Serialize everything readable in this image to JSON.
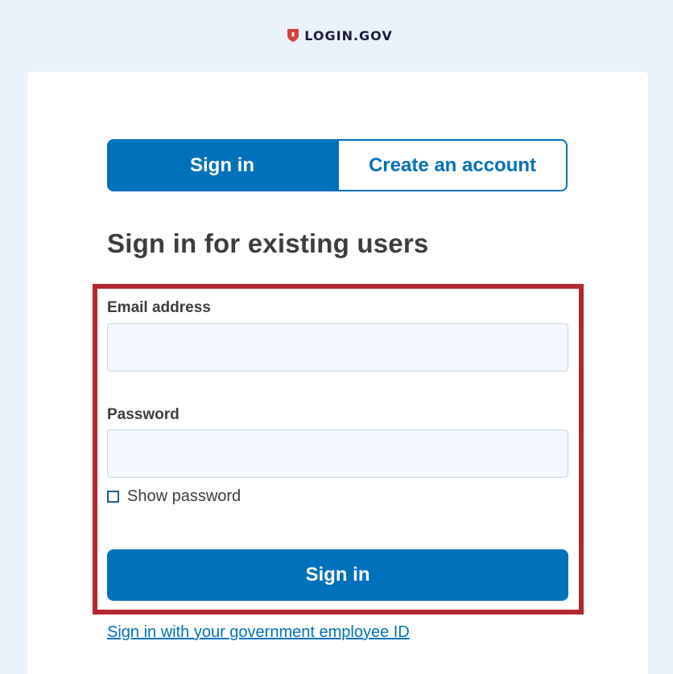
{
  "header": {
    "logo_text": "LOGIN.GOV",
    "logo_icon": "shield-icon"
  },
  "tabs": [
    {
      "label": "Sign in",
      "selected": true
    },
    {
      "label": "Create an account",
      "selected": false
    }
  ],
  "main": {
    "title": "Sign in for existing users",
    "email_label": "Email address",
    "email_value": "",
    "email_placeholder": "",
    "password_label": "Password",
    "password_value": "",
    "password_placeholder": "",
    "show_password_label": "Show password",
    "show_password_checked": false,
    "submit_label": "Sign in",
    "gov_link": "Sign in with your government employee ID"
  },
  "colors": {
    "primary": "#0071bb",
    "highlight_border": "#b3272e",
    "background": "#e9f1fa",
    "input_bg": "#f2f8fd",
    "logo_red": "#d63e3e"
  }
}
